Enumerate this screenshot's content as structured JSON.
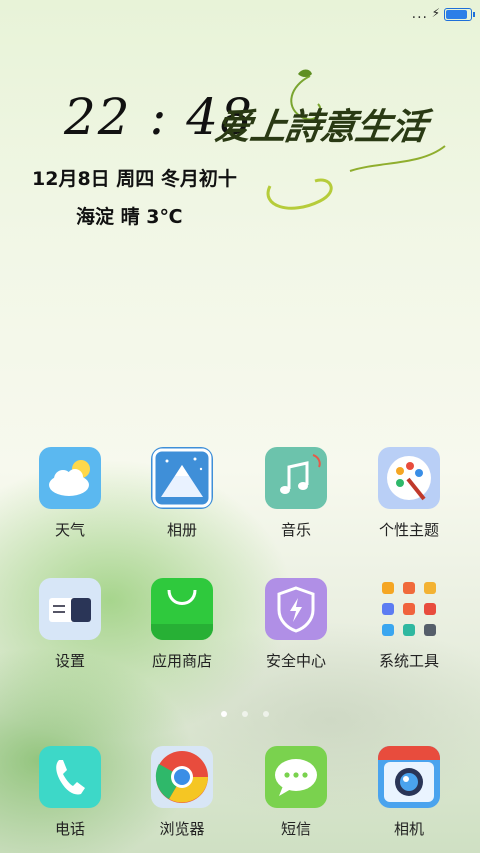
{
  "status_bar": {
    "more_dots": "...",
    "charging_symbol": "⚡",
    "battery_level": 0.92,
    "battery_color": "#2d7fe8"
  },
  "lockscreen": {
    "time": "22 : 48",
    "slogan": "爱上詩意生活",
    "date": "12月8日  周四  冬月初十",
    "weather": "海淀  晴  3℃"
  },
  "apps_row1": [
    {
      "label": "天气",
      "icon": "weather-cloud-sun-icon"
    },
    {
      "label": "相册",
      "icon": "gallery-mountain-icon"
    },
    {
      "label": "音乐",
      "icon": "music-note-icon"
    },
    {
      "label": "个性主题",
      "icon": "theme-palette-icon"
    }
  ],
  "apps_row2": [
    {
      "label": "设置",
      "icon": "settings-moon-icon"
    },
    {
      "label": "应用商店",
      "icon": "app-store-bag-icon"
    },
    {
      "label": "安全中心",
      "icon": "security-shield-icon"
    },
    {
      "label": "系统工具",
      "icon": "system-tools-folder-icon"
    }
  ],
  "dock": [
    {
      "label": "电话",
      "icon": "phone-handset-icon"
    },
    {
      "label": "浏览器",
      "icon": "browser-icon"
    },
    {
      "label": "短信",
      "icon": "message-bubble-icon"
    },
    {
      "label": "相机",
      "icon": "camera-icon"
    }
  ],
  "pages": {
    "count": 3,
    "active": 0
  },
  "colors": {
    "weather_bg": "#5bb8f0",
    "gallery_bg": "#3f8fd8",
    "music_bg": "#6cc3ac",
    "theme_bg": "#b9cff6",
    "settings_bg": "#d7e6f7",
    "store_bg": "#2fc93d",
    "security_bg": "#b08fe6",
    "phone_bg": "#3dd8c8",
    "message_bg": "#7ad24e",
    "camera_bg": "#4aa3ee"
  }
}
